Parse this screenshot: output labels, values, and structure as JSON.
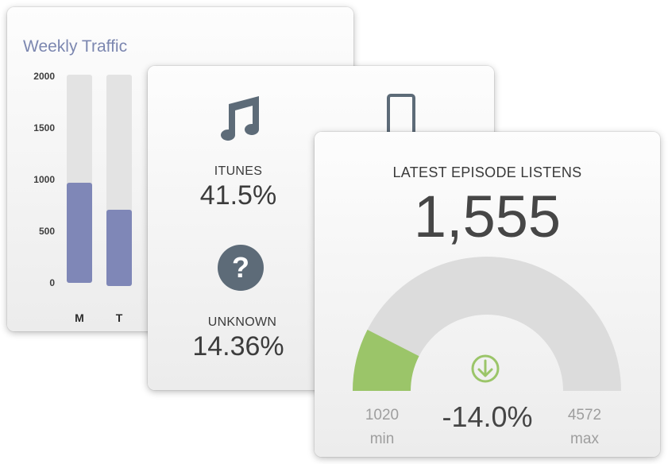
{
  "traffic": {
    "title": "Weekly Traffic",
    "y_ticks": [
      "2000",
      "1500",
      "1000",
      "500",
      "0"
    ],
    "ylim": [
      0,
      2000
    ],
    "days": [
      {
        "label": "M",
        "value": 960
      },
      {
        "label": "T",
        "value": 720
      }
    ],
    "bar_color": "#7f87b7"
  },
  "platforms": {
    "items": [
      {
        "label": "ITUNES",
        "value": "41.5%",
        "icon": "music-note-icon"
      },
      {
        "label": "UNKNOWN",
        "value": "14.36%",
        "icon": "question-icon"
      },
      {
        "icon": "mobile-phone-icon"
      }
    ]
  },
  "episode": {
    "label": "LATEST EPISODE LISTENS",
    "value": "1,555",
    "gauge": {
      "min": 1020,
      "max": 4572,
      "current": 1555,
      "min_value": "1020",
      "min_label": "min",
      "max_value": "4572",
      "max_label": "max",
      "change": "-14.0%",
      "change_icon": "down-arrow-circle-icon",
      "fill_color": "#9bc569",
      "track_color": "#dcdcdc"
    }
  }
}
